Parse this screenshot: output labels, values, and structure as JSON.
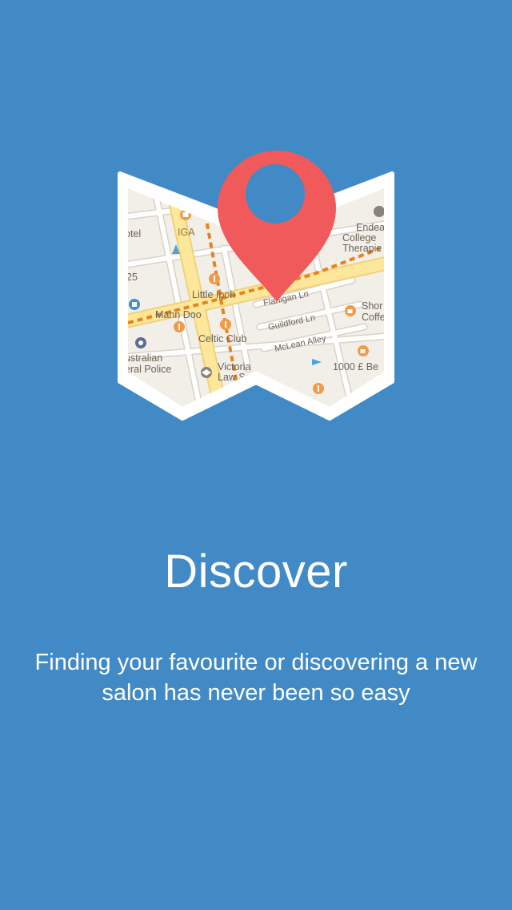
{
  "onboarding": {
    "title": "Discover",
    "description": "Finding your favourite or discovering a new salon has never been so easy"
  },
  "map": {
    "labels": {
      "hotel": "otel",
      "iga": "IGA",
      "endea": "Endea",
      "college": "College",
      "therapies": "Therapie",
      "num25": "25",
      "little_ipoh": "Little Ipoh",
      "flanigan": "Flanigan Ln",
      "guildford": "Guildford Ln",
      "mclean": "McLean Alley",
      "mahn_doo": "Mahn Doo",
      "celtic_club": "Celtic Club",
      "australian": "ustralian",
      "federal_police": "eral Police",
      "victoria": "Victoria",
      "law_school": "Law Sc",
      "shor": "Shor",
      "coffee": "Coffe",
      "thousand_pound": "1000 £ Be"
    },
    "icons": {
      "location_pin": "location-pin-icon",
      "shopping": "shopping-bag-icon",
      "restaurant": "restaurant-icon",
      "cafe": "cafe-icon",
      "school": "school-icon",
      "police": "police-icon",
      "hotel": "hotel-icon"
    }
  },
  "colors": {
    "background": "#418ac6",
    "pin": "#f05a5a",
    "map_base": "#f2efe9",
    "major_road": "#fde79a",
    "transit_dashes": "#e8821e",
    "poi": "#f29a4a"
  }
}
